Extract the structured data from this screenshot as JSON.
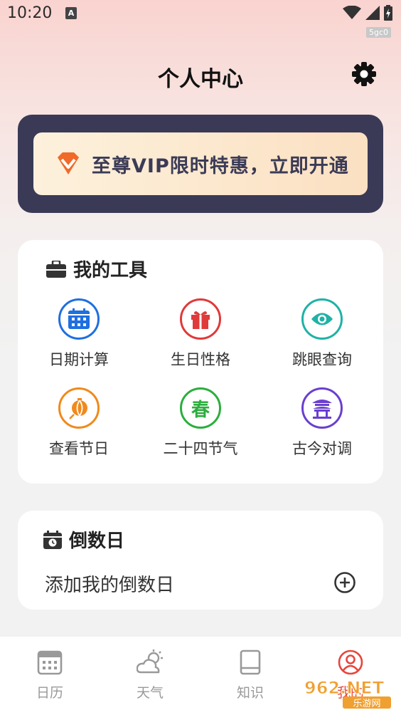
{
  "status": {
    "time": "10:20",
    "notif_letter": "A",
    "debug_tag": "5gc0"
  },
  "header": {
    "title": "个人中心"
  },
  "vip": {
    "text": "至尊VIP限时特惠，立即开通"
  },
  "tools": {
    "title": "我的工具",
    "items": [
      {
        "label": "日期计算",
        "icon": "calendar-icon",
        "color": "#1f6fe0"
      },
      {
        "label": "生日性格",
        "icon": "gift-icon",
        "color": "#e03a3a"
      },
      {
        "label": "跳眼查询",
        "icon": "eye-icon",
        "color": "#1fb2a6"
      },
      {
        "label": "查看节日",
        "icon": "lantern-icon",
        "color": "#f08a1c"
      },
      {
        "label": "二十四节气",
        "icon": "spring-icon",
        "glyph": "春",
        "color": "#2cae3e"
      },
      {
        "label": "古今对调",
        "icon": "pavilion-icon",
        "color": "#6a3fd0"
      }
    ]
  },
  "countdown": {
    "title": "倒数日",
    "add_label": "添加我的倒数日"
  },
  "tabbar": {
    "items": [
      {
        "label": "日历",
        "icon": "calendar-grid-icon"
      },
      {
        "label": "天气",
        "icon": "weather-icon"
      },
      {
        "label": "知识",
        "icon": "book-icon"
      },
      {
        "label": "我的",
        "icon": "user-icon",
        "active": true
      }
    ]
  },
  "watermark": {
    "text": "962.NET",
    "sub": "乐游网"
  }
}
